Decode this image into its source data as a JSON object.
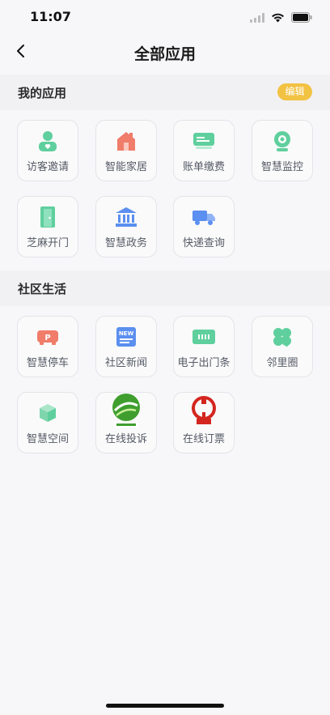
{
  "status": {
    "time": "11:07"
  },
  "nav": {
    "title": "全部应用"
  },
  "my_apps": {
    "title": "我的应用",
    "edit_label": "编辑",
    "items": [
      {
        "label": "访客邀请",
        "icon": "visitor-icon"
      },
      {
        "label": "智能家居",
        "icon": "smart-home-icon"
      },
      {
        "label": "账单缴费",
        "icon": "bill-icon"
      },
      {
        "label": "智慧监控",
        "icon": "camera-icon"
      },
      {
        "label": "芝麻开门",
        "icon": "door-icon"
      },
      {
        "label": "智慧政务",
        "icon": "government-icon"
      },
      {
        "label": "快递查询",
        "icon": "delivery-truck-icon"
      }
    ]
  },
  "community": {
    "title": "社区生活",
    "items": [
      {
        "label": "智慧停车",
        "icon": "parking-icon"
      },
      {
        "label": "社区新闻",
        "icon": "news-icon"
      },
      {
        "label": "电子出门条",
        "icon": "pass-card-icon"
      },
      {
        "label": "邻里圈",
        "icon": "clover-icon"
      },
      {
        "label": "智慧空间",
        "icon": "cube-icon"
      },
      {
        "label": "在线投诉",
        "icon": "complaint-logo-icon"
      },
      {
        "label": "在线订票",
        "icon": "railway-logo-icon"
      }
    ]
  },
  "colors": {
    "accent": "#f2c243",
    "green": "#5fcf9d",
    "red": "#f07c6a",
    "blue": "#5b8ff0"
  }
}
